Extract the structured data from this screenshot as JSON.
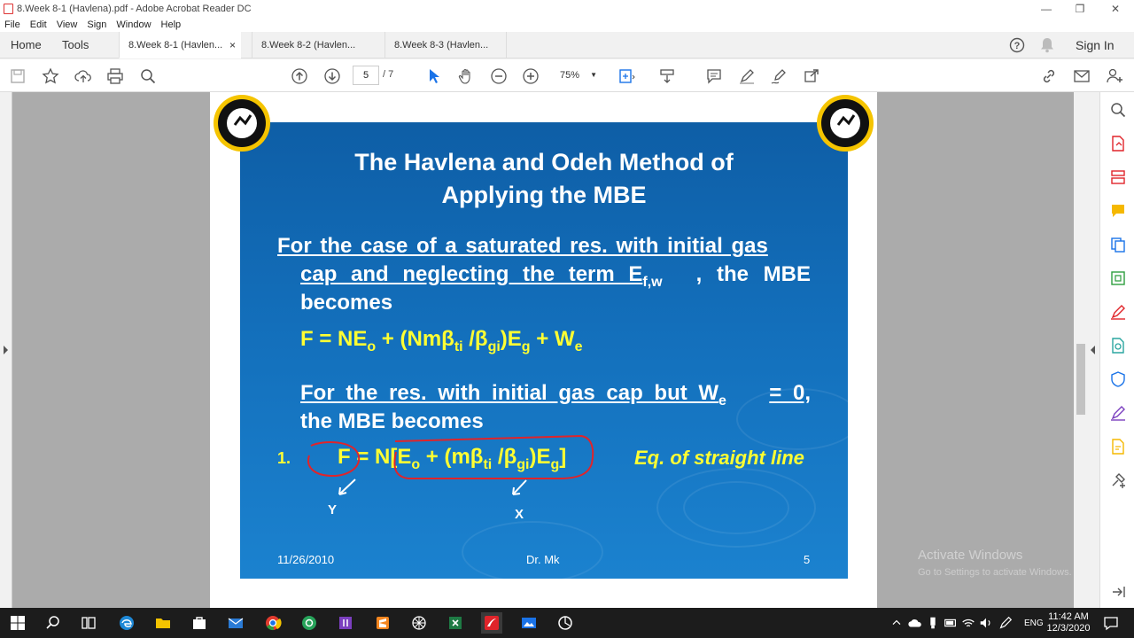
{
  "window": {
    "title": "8.Week 8-1 (Havlena).pdf - Adobe Acrobat Reader DC",
    "minimize": "—",
    "maximize": "❐",
    "close": "✕"
  },
  "menu": [
    "File",
    "Edit",
    "View",
    "Sign",
    "Window",
    "Help"
  ],
  "nav": {
    "home": "Home",
    "tools": "Tools",
    "sign_in": "Sign In"
  },
  "tabs": [
    {
      "label": "8.Week 8-1 (Havlen...",
      "close": "×"
    },
    {
      "label": "8.Week 8-2 (Havlen..."
    },
    {
      "label": "8.Week 8-3 (Havlen..."
    }
  ],
  "toolbar": {
    "page_current": "5",
    "page_total": "/ 7",
    "zoom": "75%"
  },
  "slide": {
    "title_line1": "The Havlena and Odeh Method of",
    "title_line2": "Applying the MBE",
    "p1_line1": "For the case of a saturated res. with initial gas",
    "p1_line2a": "cap and neglecting the term E",
    "p1_line2_sub": "f,w",
    "p1_line2b": ", the MBE",
    "p1_line3": "becomes",
    "eq1": {
      "a": "F = NE",
      "a_sub": "o",
      "b": " + (Nmβ",
      "b_sub": "ti",
      "c": " /β",
      "c_sub": "gi",
      "d": ")E",
      "d_sub": "g",
      "e": " + W",
      "e_sub": "e"
    },
    "p2_line1a": "For the res. with initial gas cap but W",
    "p2_line1_sub": "e",
    "p2_line1b": " = 0,",
    "p2_line2": "the MBE becomes",
    "item_number": "1.",
    "eq2": {
      "a": "F = N[E",
      "a_sub": "o",
      "b": " + (mβ",
      "b_sub": "ti",
      "c": " /β",
      "c_sub": "gi",
      "d": ")E",
      "d_sub": "g",
      "e": "]"
    },
    "eq_note": "Eq. of straight line",
    "annot_y": "Y",
    "annot_x": "X",
    "footer_date": "11/26/2010",
    "footer_author": "Dr. Mk",
    "footer_page": "5"
  },
  "os_watermark": {
    "line1": "Activate Windows",
    "line2": "Go to Settings to activate Windows."
  },
  "taskbar": {
    "lang": "ENG",
    "time": "11:42 AM",
    "date": "12/3/2020"
  },
  "colors": {
    "slide_text_accent": "#ffff33",
    "annotation_red": "#e0242a",
    "acrobat_red": "#e0242a"
  }
}
